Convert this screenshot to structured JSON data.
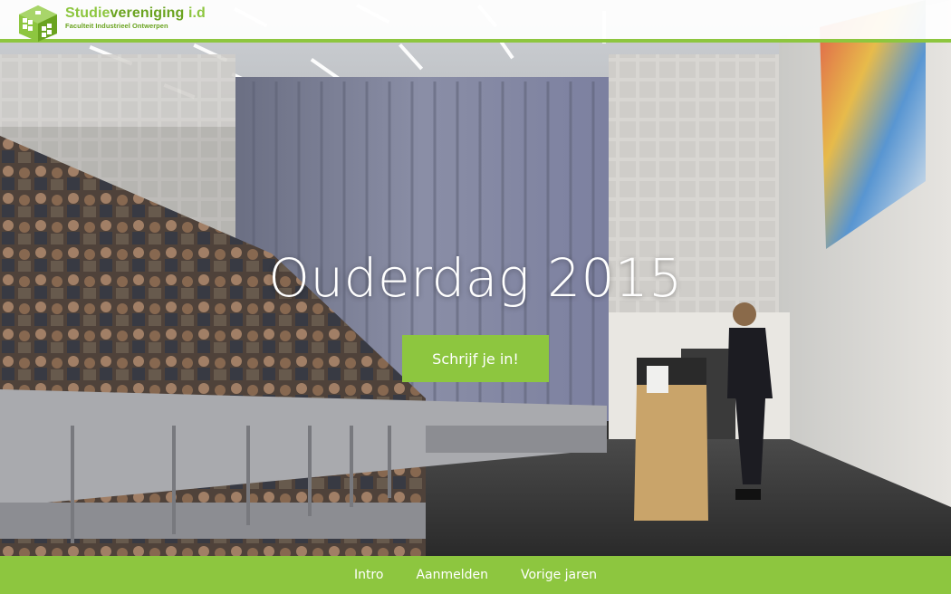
{
  "brand": {
    "title_part1": "Studie",
    "title_part2": "vereniging",
    "title_part3": " i.d",
    "subtitle": "Faculteit Industrieel Ontwerpen",
    "logo_icon": "green-cube-logo",
    "color_accent": "#8dc63f",
    "color_accent_dark": "#6aa31f"
  },
  "hero": {
    "title": "Ouderdag 2015",
    "cta_label": "Schrijf je in!",
    "background": "lecture-hall-photo"
  },
  "nav": {
    "items": [
      {
        "label": "Intro"
      },
      {
        "label": "Aanmelden"
      },
      {
        "label": "Vorige jaren"
      }
    ]
  }
}
